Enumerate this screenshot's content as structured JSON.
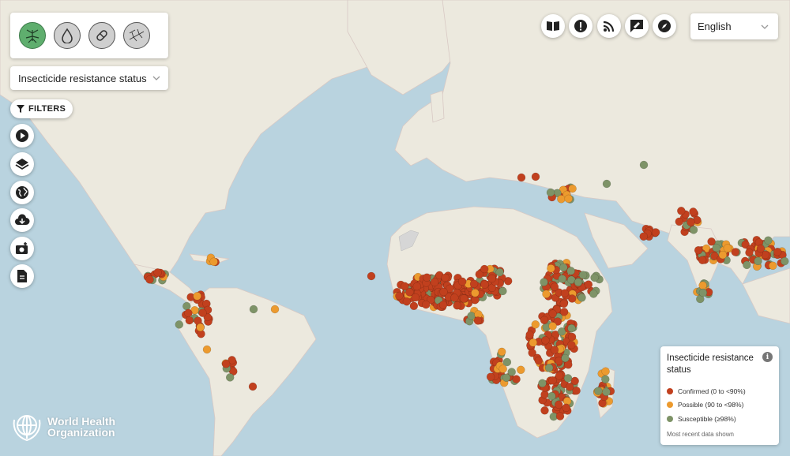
{
  "theme_buttons": [
    {
      "icon": "mosquito-icon",
      "active": true
    },
    {
      "icon": "drop-icon",
      "active": false
    },
    {
      "icon": "pill-icon",
      "active": false
    },
    {
      "icon": "mosquitoes-icon",
      "active": false
    }
  ],
  "map_layer_select": {
    "value": "Insecticide resistance status"
  },
  "filters_label": "FILTERS",
  "side_tools": [
    "play-icon",
    "layers-icon",
    "globe-icon",
    "download-icon",
    "screenshot-icon",
    "report-icon"
  ],
  "top_tools": [
    "book-icon",
    "alert-icon",
    "rss-icon",
    "feedback-icon",
    "compass-icon"
  ],
  "language": {
    "value": "English"
  },
  "legend": {
    "title": "Insecticide resistance status",
    "items": [
      {
        "label": "Confirmed (0 to <90%)",
        "color": "#c1401e"
      },
      {
        "label": "Possible (90 to <98%)",
        "color": "#ec9a2e"
      },
      {
        "label": "Susceptible (≥98%)",
        "color": "#7e9367"
      }
    ],
    "footnote": "Most recent data shown"
  },
  "logo": {
    "line1": "World Health",
    "line2": "Organization"
  },
  "colors": {
    "confirmed": "#c1401e",
    "possible": "#ec9a2e",
    "susceptible": "#7e9367",
    "ocean": "#b9d3df",
    "land": "#ece9de"
  }
}
